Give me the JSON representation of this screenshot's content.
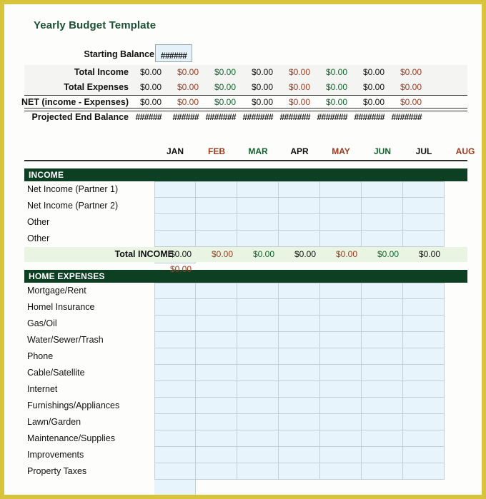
{
  "document": {
    "title": "Yearly Budget Template",
    "frame_color": "#d8c43c",
    "accent_green": "#0d4023",
    "title_color": "#1d5136"
  },
  "summary": {
    "starting_balance": {
      "label": "Starting Balance",
      "value": "######"
    },
    "rows": [
      {
        "label": "Total Income",
        "values": [
          "$0.00",
          "$0.00",
          "$0.00",
          "$0.00",
          "$0.00",
          "$0.00",
          "$0.00",
          "$0.00"
        ]
      },
      {
        "label": "Total Expenses",
        "values": [
          "$0.00",
          "$0.00",
          "$0.00",
          "$0.00",
          "$0.00",
          "$0.00",
          "$0.00",
          "$0.00"
        ]
      },
      {
        "label": "NET (income - Expenses)",
        "values": [
          "$0.00",
          "$0.00",
          "$0.00",
          "$0.00",
          "$0.00",
          "$0.00",
          "$0.00",
          "$0.00"
        ]
      },
      {
        "label": "Projected End Balance",
        "values": [
          "######",
          "######",
          "#######",
          "#######",
          "#######",
          "#######",
          "#######",
          "#######"
        ]
      }
    ]
  },
  "months": [
    {
      "label": "JAN",
      "color": "#111111"
    },
    {
      "label": "FEB",
      "color": "#9e3b1f"
    },
    {
      "label": "MAR",
      "color": "#10662f"
    },
    {
      "label": "APR",
      "color": "#111111"
    },
    {
      "label": "MAY",
      "color": "#9e3b1f"
    },
    {
      "label": "JUN",
      "color": "#10662f"
    },
    {
      "label": "JUL",
      "color": "#111111"
    },
    {
      "label": "AUG",
      "color": "#9e3b1f"
    }
  ],
  "sections": [
    {
      "heading": "INCOME",
      "rows": [
        "Net Income  (Partner 1)",
        "Net Income (Partner 2)",
        "Other",
        "Other"
      ],
      "total": {
        "label": "Total INCOME",
        "values": [
          "$0.00",
          "$0.00",
          "$0.00",
          "$0.00",
          "$0.00",
          "$0.00",
          "$0.00",
          "$0.00"
        ]
      }
    },
    {
      "heading": "HOME EXPENSES",
      "rows": [
        "Mortgage/Rent",
        "Homel Insurance",
        "Gas/Oil",
        "Water/Sewer/Trash",
        "Phone",
        "Cable/Satellite",
        "Internet",
        "Furnishings/Appliances",
        "Lawn/Garden",
        "Maintenance/Supplies",
        "Improvements",
        "Property Taxes"
      ],
      "total": null
    }
  ],
  "value_color_cycle": [
    "#111111",
    "#9e3b1f",
    "#10662f"
  ]
}
